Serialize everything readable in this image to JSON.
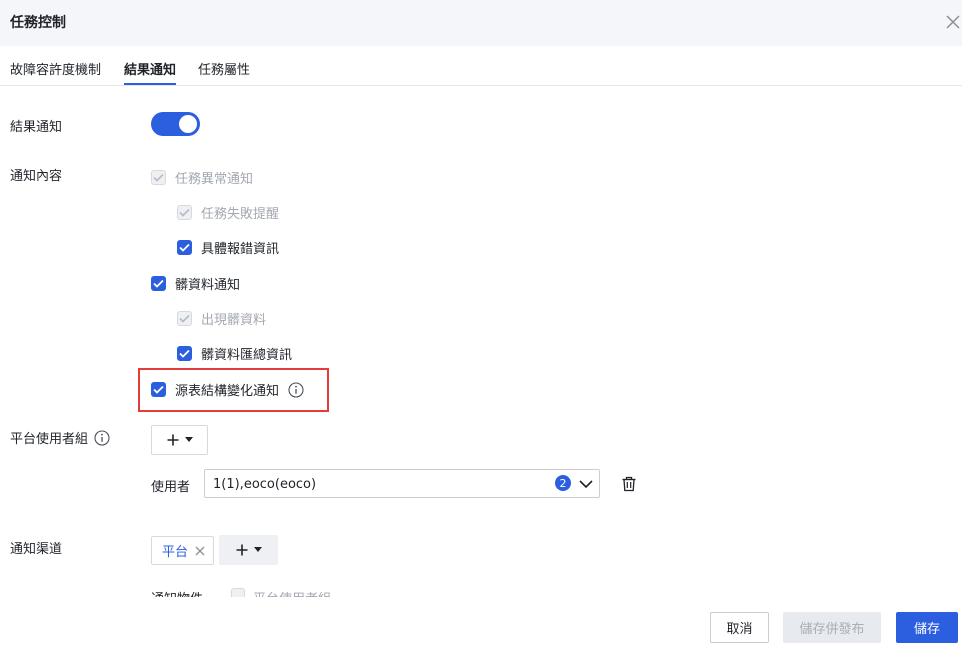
{
  "dialog": {
    "title": "任務控制"
  },
  "tabs": [
    {
      "label": "故障容許度機制",
      "active": false
    },
    {
      "label": "結果通知",
      "active": true
    },
    {
      "label": "任務屬性",
      "active": false
    }
  ],
  "form": {
    "result_notify": {
      "label": "結果通知",
      "enabled": true
    },
    "notify_content": {
      "label": "通知內容",
      "options": [
        {
          "label": "任務異常通知",
          "checked": true,
          "disabled": true
        },
        {
          "label": "任務失敗提醒",
          "checked": true,
          "disabled": true
        },
        {
          "label": "具體報錯資訊",
          "checked": true,
          "disabled": false
        },
        {
          "label": "髒資料通知",
          "checked": true,
          "disabled": false
        },
        {
          "label": "出現髒資料",
          "checked": true,
          "disabled": true
        },
        {
          "label": "髒資料匯總資訊",
          "checked": true,
          "disabled": false
        },
        {
          "label": "源表結構變化通知",
          "checked": true,
          "disabled": false
        }
      ]
    },
    "platform_user_group": {
      "label": "平台使用者組",
      "user_label": "使用者",
      "user_value": "1(1),eoco(eoco)",
      "user_count": "2"
    },
    "notify_channel": {
      "label": "通知渠道",
      "chip": "平台",
      "partial_label": "通知物件",
      "partial_option": "平台使用者組"
    }
  },
  "footer": {
    "cancel": "取消",
    "save_publish": "儲存併發布",
    "save": "儲存"
  },
  "colors": {
    "accent": "#2b5fe0",
    "highlight": "#e63b3b"
  }
}
